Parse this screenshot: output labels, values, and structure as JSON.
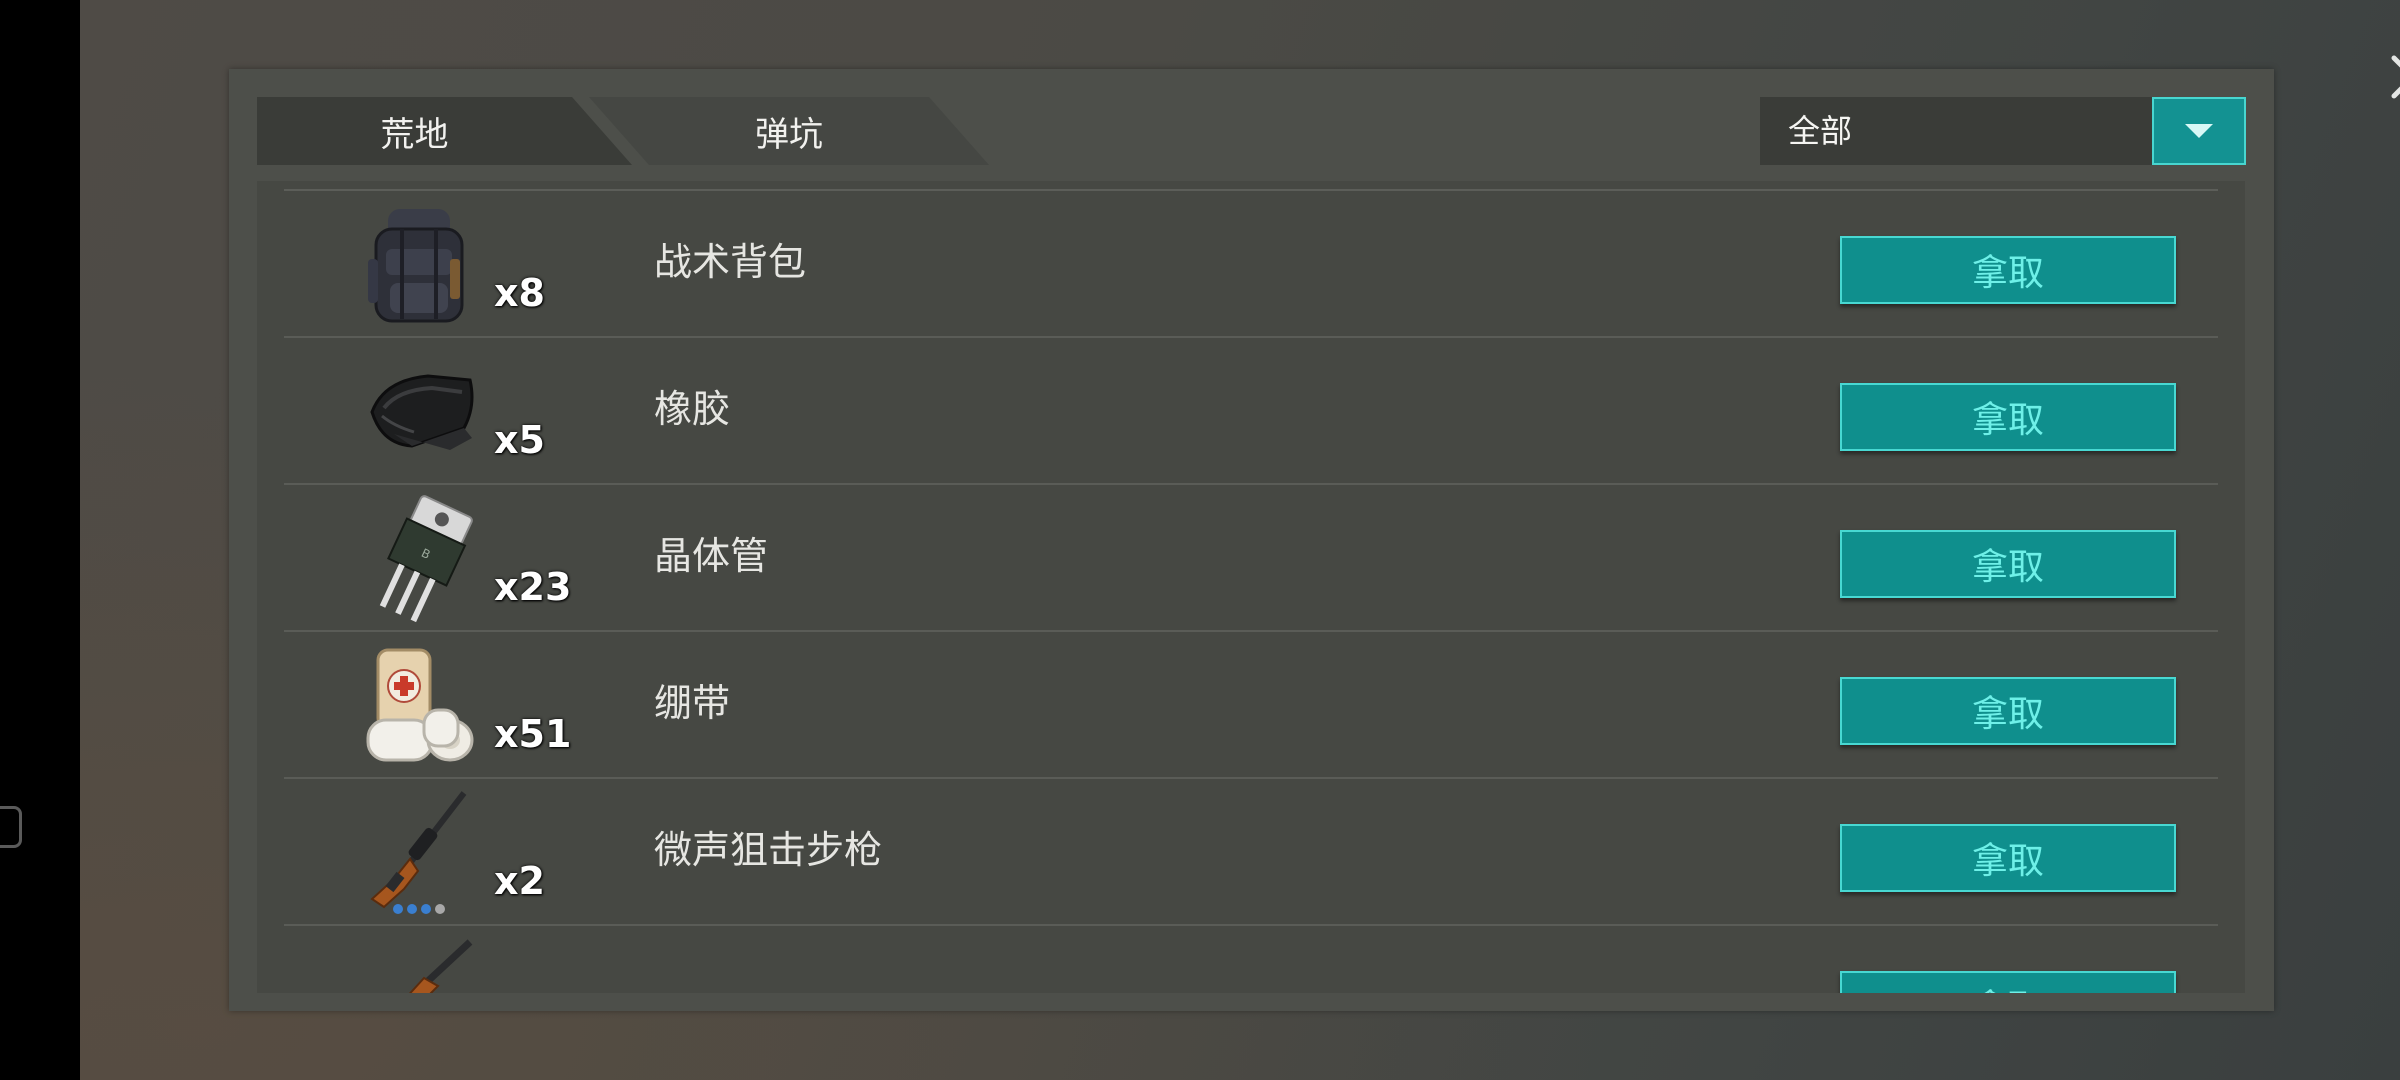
{
  "tabs": [
    {
      "label": "荒地",
      "active": true
    },
    {
      "label": "弹坑",
      "active": false
    }
  ],
  "filter": {
    "selected": "全部"
  },
  "close": {
    "label": "关闭"
  },
  "action_label": "拿取",
  "items": [
    {
      "name": "战术背包",
      "count": "x8",
      "icon": "backpack-icon"
    },
    {
      "name": "橡胶",
      "count": "x5",
      "icon": "rubber-icon"
    },
    {
      "name": "晶体管",
      "count": "x23",
      "icon": "transistor-icon"
    },
    {
      "name": "绷带",
      "count": "x51",
      "icon": "bandage-icon"
    },
    {
      "name": "微声狙击步枪",
      "count": "x2",
      "icon": "sniper-rifle-icon"
    },
    {
      "name": "",
      "count": "",
      "icon": "shotgun-icon"
    }
  ],
  "colors": {
    "accent": "#139292",
    "accent_border": "#48d6d0",
    "button_text": "#6ef0e8",
    "panel": "#4d4f4a"
  }
}
